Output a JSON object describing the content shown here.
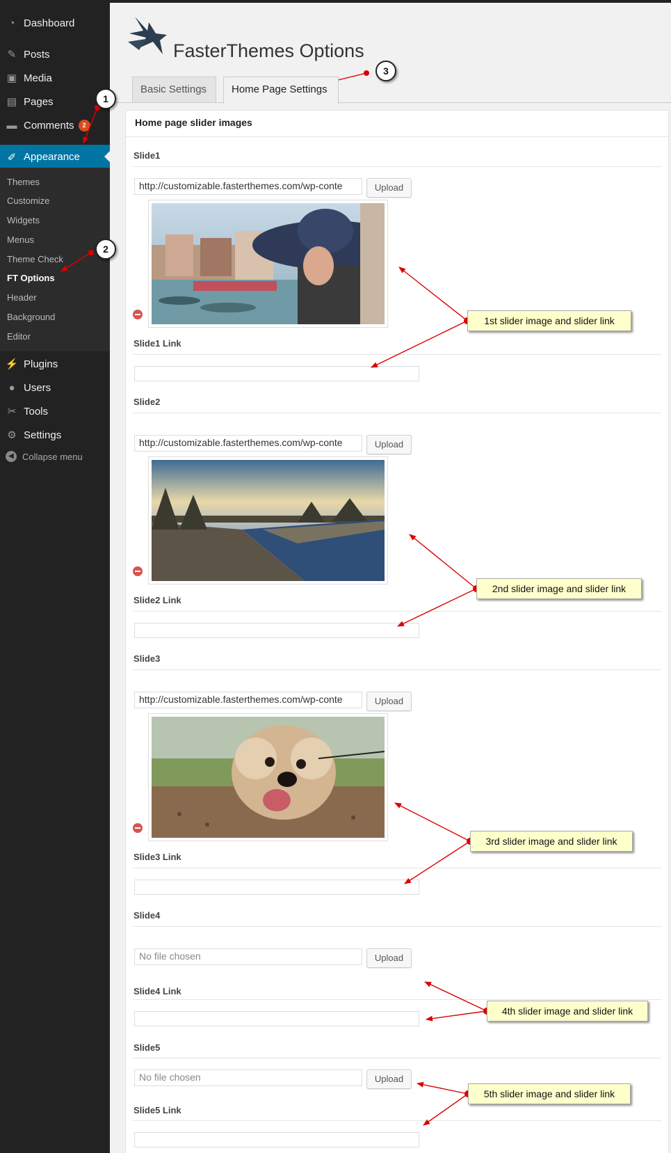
{
  "sidebar": {
    "menu": [
      {
        "label": "Dashboard",
        "icon": "dashboard-icon"
      },
      {
        "label": "Posts",
        "icon": "pin-icon"
      },
      {
        "label": "Media",
        "icon": "media-icon"
      },
      {
        "label": "Pages",
        "icon": "pages-icon"
      },
      {
        "label": "Comments",
        "icon": "comment-icon",
        "badge": "2"
      },
      {
        "label": "Appearance",
        "icon": "paintbrush-icon",
        "current": true
      },
      {
        "label": "Plugins",
        "icon": "plug-icon"
      },
      {
        "label": "Users",
        "icon": "user-icon"
      },
      {
        "label": "Tools",
        "icon": "wrench-icon"
      },
      {
        "label": "Settings",
        "icon": "settings-icon"
      }
    ],
    "submenu": [
      "Themes",
      "Customize",
      "Widgets",
      "Menus",
      "Theme Check",
      "FT Options",
      "Header",
      "Background",
      "Editor"
    ],
    "submenu_current": "FT Options",
    "collapse_label": "Collapse menu"
  },
  "page": {
    "title": "FasterThemes Options",
    "tabs": [
      {
        "label": "Basic Settings",
        "active": false
      },
      {
        "label": "Home Page Settings",
        "active": true
      }
    ]
  },
  "panel": {
    "section_title": "Home page slider images",
    "upload_label": "Upload",
    "slides": [
      {
        "label": "Slide1",
        "value": "http://customizable.fasterthemes.com/wp-conte",
        "has_image": true,
        "image": "canal scene with woman in hat",
        "link_label": "Slide1 Link",
        "link_value": ""
      },
      {
        "label": "Slide2",
        "value": "http://customizable.fasterthemes.com/wp-conte",
        "has_image": true,
        "image": "river embankment at sunset",
        "link_label": "Slide2 Link",
        "link_value": ""
      },
      {
        "label": "Slide3",
        "value": "http://customizable.fasterthemes.com/wp-conte",
        "has_image": true,
        "image": "small dog close-up",
        "link_label": "Slide3 Link",
        "link_value": ""
      },
      {
        "label": "Slide4",
        "value": "No file chosen",
        "has_image": false,
        "link_label": "Slide4 Link",
        "link_value": ""
      },
      {
        "label": "Slide5",
        "value": "No file chosen",
        "has_image": false,
        "link_label": "Slide5 Link",
        "link_value": ""
      }
    ]
  },
  "annotations": {
    "steps": [
      "1",
      "2",
      "3"
    ],
    "callouts": [
      "1st slider image and slider link",
      "2nd slider image and slider link",
      "3rd slider image and slider link",
      "4th slider image and slider link",
      "5th slider image and slider link"
    ]
  },
  "colors": {
    "sidebar_bg": "#222222",
    "active_menu": "#0074a2",
    "badge": "#d54e21",
    "callout_bg": "#ffffcc",
    "arrow": "#dd0000"
  }
}
